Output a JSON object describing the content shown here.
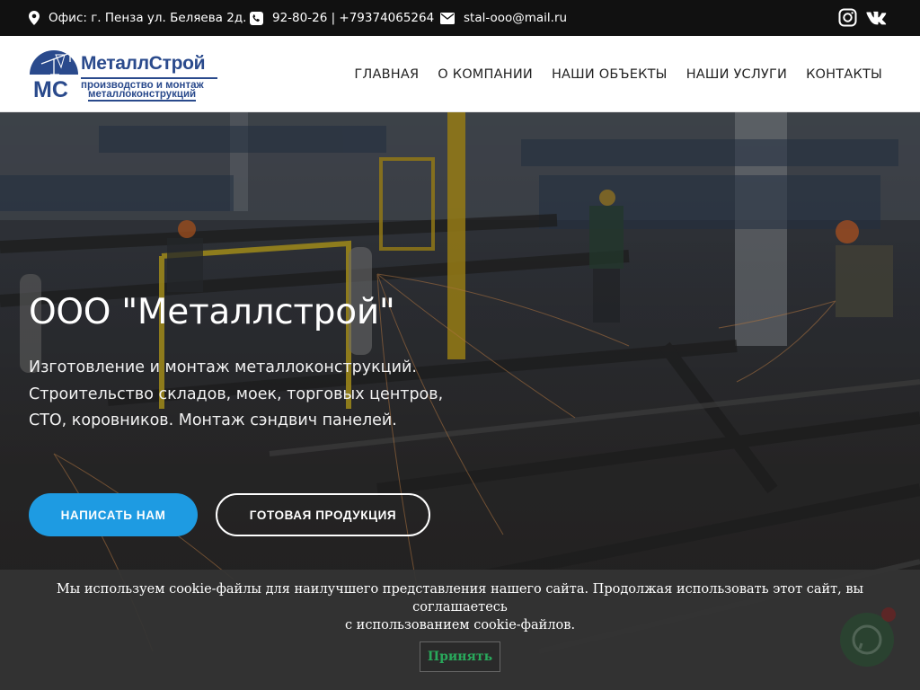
{
  "topbar": {
    "address": "Офис: г. Пенза ул. Беляева 2д.",
    "phone": "92-80-26 | +79374065264",
    "email": "stal-ooo@mail.ru",
    "social": [
      "instagram-icon",
      "vk-icon"
    ]
  },
  "logo": {
    "initials": "МС",
    "brand": "МеталлСтрой",
    "tagline_1": "производство и монтаж",
    "tagline_2": "металлоконструкций"
  },
  "nav": {
    "items": [
      "ГЛАВНАЯ",
      "О КОМПАНИИ",
      "НАШИ ОБЪЕКТЫ",
      "НАШИ УСЛУГИ",
      "КОНТАКТЫ"
    ]
  },
  "hero": {
    "title": "ООО \"Металлстрой\"",
    "line_1": "Изготовление и монтаж металлоконструкций.",
    "line_2": "Строительство складов, моек, торговых центров,",
    "line_3": "СТО, коровников. Монтаж сэндвич панелей.",
    "primary_button": "НАПИСАТЬ НАМ",
    "secondary_button": "ГОТОВАЯ ПРОДУКЦИЯ"
  },
  "cookie": {
    "text_1": "Мы используем cookie-файлы для наилучшего представления нашего сайта. Продолжая использовать этот сайт, вы соглашаетесь",
    "text_2": "с использованием cookie-файлов.",
    "accept": "Принять"
  },
  "colors": {
    "accent": "#1e9be2",
    "brand": "#2a4a8c",
    "accept_text": "#29a85b"
  }
}
